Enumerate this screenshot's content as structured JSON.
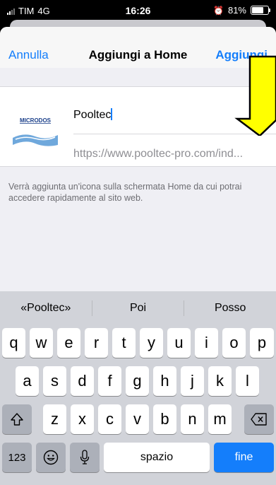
{
  "status_bar": {
    "carrier": "TIM",
    "network": "4G",
    "time": "16:26",
    "battery": "81%",
    "battery_level": 0.81
  },
  "navbar": {
    "cancel_label": "Annulla",
    "title": "Aggiungi a Home",
    "add_label": "Aggiungi"
  },
  "form": {
    "name_value": "Pooltec",
    "url_value": "https://www.pooltec-pro.com/ind...",
    "thumbnail_logo_text": "MICRODOS"
  },
  "info_text": "Verrà aggiunta un'icona sulla schermata Home da cui potrai accedere rapidamente al sito web.",
  "keyboard": {
    "predictions": [
      "«Pooltec»",
      "Poi",
      "Posso"
    ],
    "row1": [
      "q",
      "w",
      "e",
      "r",
      "t",
      "y",
      "u",
      "i",
      "o",
      "p"
    ],
    "row2": [
      "a",
      "s",
      "d",
      "f",
      "g",
      "h",
      "j",
      "k",
      "l"
    ],
    "row3": [
      "z",
      "x",
      "c",
      "v",
      "b",
      "n",
      "m"
    ],
    "numbers_label": "123",
    "space_label": "spazio",
    "return_label": "fine"
  },
  "colors": {
    "accent": "#147efb",
    "annotation": "#ffff00"
  }
}
